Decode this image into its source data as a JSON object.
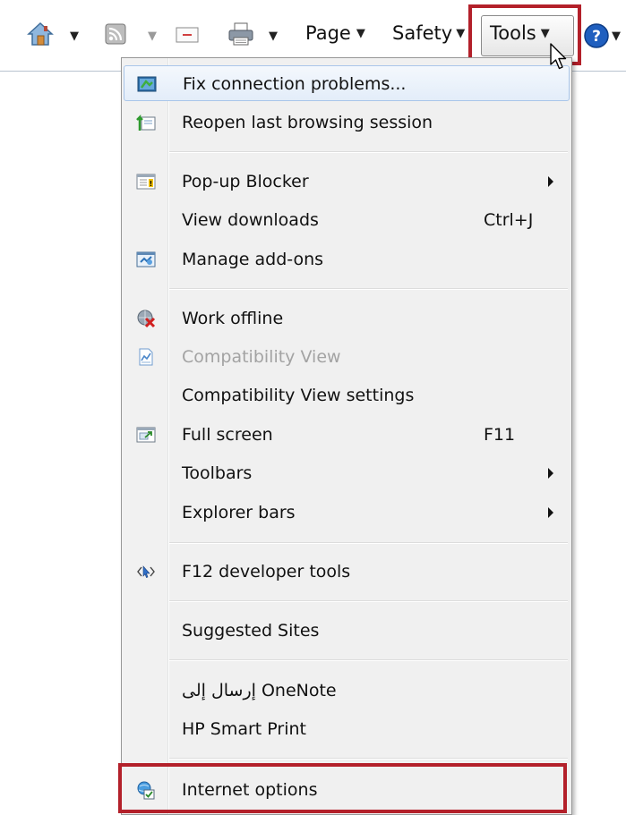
{
  "toolbar": {
    "page_label": "Page",
    "safety_label": "Safety",
    "tools_label": "Tools"
  },
  "menu": {
    "items": [
      {
        "label": "Fix connection problems...",
        "icon": "fix-connection-icon"
      },
      {
        "label": "Reopen last browsing session",
        "icon": "reopen-session-icon"
      },
      {
        "label": "Pop-up Blocker",
        "icon": "popup-blocker-icon",
        "submenu": true
      },
      {
        "label": "View downloads",
        "shortcut": "Ctrl+J"
      },
      {
        "label": "Manage add-ons",
        "icon": "add-ons-icon"
      },
      {
        "label": "Work offline",
        "icon": "work-offline-icon"
      },
      {
        "label": "Compatibility View",
        "icon": "compatibility-view-icon",
        "disabled": true
      },
      {
        "label": "Compatibility View settings"
      },
      {
        "label": "Full screen",
        "icon": "full-screen-icon",
        "shortcut": "F11"
      },
      {
        "label": "Toolbars",
        "submenu": true
      },
      {
        "label": "Explorer bars",
        "submenu": true
      },
      {
        "label": "F12 developer tools",
        "icon": "developer-tools-icon"
      },
      {
        "label": "Suggested Sites"
      },
      {
        "label": "إرسال إلى OneNote"
      },
      {
        "label": "HP Smart Print"
      },
      {
        "label": "Internet options",
        "icon": "internet-options-icon"
      }
    ]
  },
  "colors": {
    "highlight_border": "#b3202a",
    "menu_background": "#f0f0f0",
    "hover_border": "#a9c6ea"
  }
}
